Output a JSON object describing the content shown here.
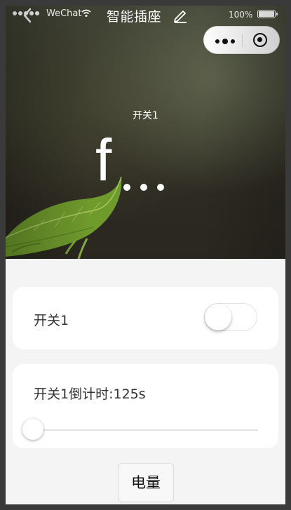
{
  "status": {
    "carrier": "WeChat",
    "battery": "100%"
  },
  "nav": {
    "title": "智能插座",
    "back_icon": "chevron-left-icon",
    "edit_icon": "pencil-icon",
    "menu_icon": "more-dots-icon",
    "close_icon": "target-circle-icon"
  },
  "hero": {
    "switch_name": "开关1",
    "state_text": "f",
    "state_ellipsis": "..."
  },
  "switch_card": {
    "label": "开关1",
    "toggle_on": false
  },
  "timer_card": {
    "label": "开关1倒计时:125s",
    "slider_value": 0
  },
  "power_button": {
    "label": "电量"
  },
  "colors": {
    "page_bg": "#f4f4f4",
    "card_bg": "#ffffff",
    "frame": "#3a3a3a"
  }
}
